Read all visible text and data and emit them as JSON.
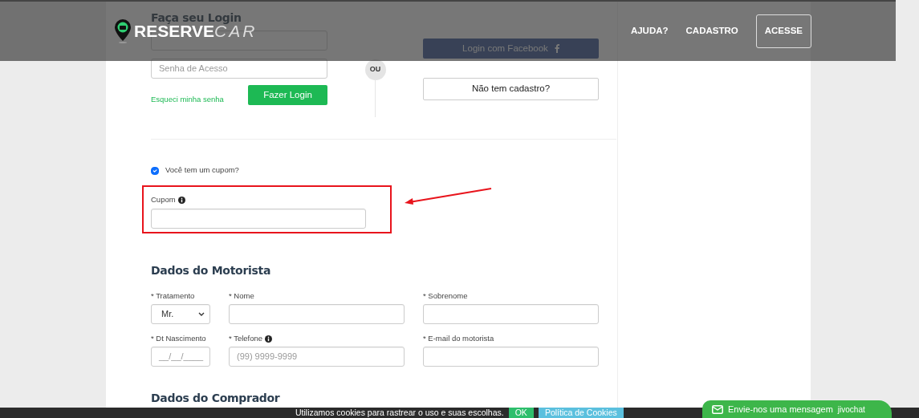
{
  "header": {
    "logo": {
      "strong": "RESERVE",
      "light": "CAR"
    },
    "nav": [
      {
        "label": "AJUDA?",
        "kind": "link"
      },
      {
        "label": "CADASTRO",
        "kind": "link"
      },
      {
        "label": "ACESSE",
        "kind": "outlined"
      }
    ]
  },
  "login": {
    "title": "Faça seu Login",
    "password_placeholder": "Senha de Acesso",
    "submit": "Fazer Login",
    "forgot": "Esqueci minha senha",
    "separator": "OU",
    "facebook": "Login com Facebook",
    "signup": "Não tem cadastro?"
  },
  "coupon": {
    "checkbox_label": "Você tem um cupom?",
    "checked": true,
    "field_label": "Cupom",
    "info": true
  },
  "driver": {
    "title": "Dados do Motorista",
    "fields": [
      {
        "label": "* Tratamento",
        "kind": "select",
        "value": "Mr.",
        "info": false
      },
      {
        "label": "* Nome",
        "kind": "input",
        "info": false
      },
      {
        "label": "* Sobrenome",
        "kind": "input",
        "info": false
      },
      {
        "label": "* Dt Nascimento",
        "kind": "input",
        "placeholder": "__/__/____",
        "info": false
      },
      {
        "label": "* Telefone",
        "kind": "input",
        "placeholder": "(99) 9999-9999",
        "info": true
      },
      {
        "label": "* E-mail do motorista",
        "kind": "input",
        "info": false
      }
    ]
  },
  "buyer": {
    "title": "Dados do Comprador"
  },
  "cookie_bar": {
    "text": "Utilizamos cookies para rastrear o uso e suas escolhas.",
    "accept": "OK",
    "policy": "Política de Cookies"
  },
  "chat": {
    "label": "Envie-nos uma mensagem",
    "brand": "jivochat"
  }
}
